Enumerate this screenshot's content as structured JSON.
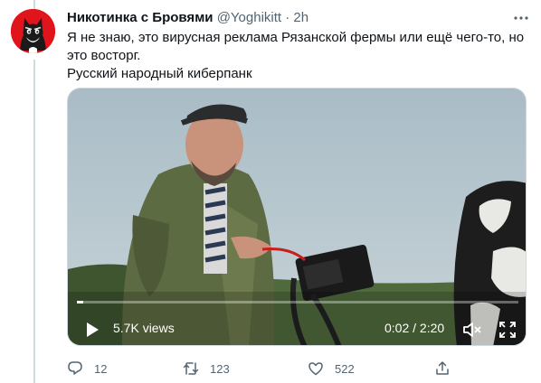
{
  "tweet": {
    "author_name": "Никотинка с Бровями",
    "author_handle": "@Yoghikitt",
    "separator": "·",
    "time": "2h",
    "text_lines": [
      "Я не знаю, это вирусная реклама Рязанской фермы или ещё чего-то, но",
      "это восторг.",
      "Русский народный киберпанк"
    ]
  },
  "video": {
    "views": "5.7K views",
    "timestamp": "0:02 / 2:20",
    "progress": 0.015
  },
  "actions": {
    "reply_count": "12",
    "retweet_count": "123",
    "like_count": "522"
  },
  "colors": {
    "accent": "#1d9bf0",
    "muted": "#536471",
    "avatar_bg": "#e0141b"
  }
}
